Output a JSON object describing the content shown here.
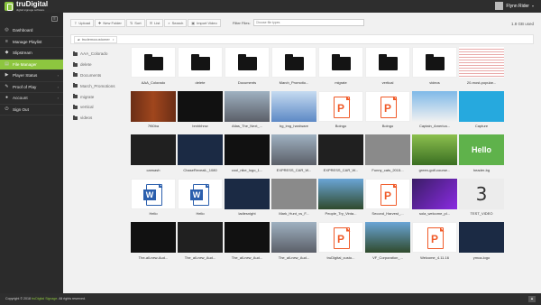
{
  "app": {
    "logo_text": "truDigital",
    "logo_subtext": "digital signage software"
  },
  "user": {
    "name": "Flynn Rider"
  },
  "nav": [
    {
      "label": "Dashboard",
      "icon": "dashboard-icon",
      "glyph": "◎"
    },
    {
      "label": "Manage Playlist",
      "icon": "playlist-icon",
      "glyph": "≡"
    },
    {
      "label": "Slipstream",
      "icon": "slipstream-icon",
      "glyph": "◆"
    },
    {
      "label": "File Manager",
      "icon": "folder-icon",
      "glyph": "▤",
      "active": true
    },
    {
      "label": "Player Status",
      "icon": "player-icon",
      "glyph": "▶",
      "chevron": true
    },
    {
      "label": "Proof of Play",
      "icon": "proof-icon",
      "glyph": "✎",
      "chevron": true
    },
    {
      "label": "Account",
      "icon": "account-icon",
      "glyph": "●",
      "chevron": true
    },
    {
      "label": "Sign Out",
      "icon": "signout-icon",
      "glyph": "⏻"
    }
  ],
  "toolbar": {
    "upload": "Upload",
    "new_folder": "New Folder",
    "sort": "Sort",
    "list": "List",
    "search": "Search",
    "import_video": "Import Video"
  },
  "filter": {
    "label": "Filter Files:",
    "placeholder": "Choose file types"
  },
  "usage": "1.8 GB used",
  "breadcrumb": {
    "label": "trudemocustomer"
  },
  "tree": [
    "AAA_Colorado",
    "delete",
    "Documents",
    "March_Promotions",
    "migrate",
    "vertical",
    "videos"
  ],
  "files": [
    {
      "name": "AAA_Colorado",
      "kind": "folder"
    },
    {
      "name": "delete",
      "kind": "folder"
    },
    {
      "name": "Documents",
      "kind": "folder"
    },
    {
      "name": "March_Promotio...",
      "kind": "folder"
    },
    {
      "name": "migrate",
      "kind": "folder"
    },
    {
      "name": "vertical",
      "kind": "folder"
    },
    {
      "name": "videos",
      "kind": "folder"
    },
    {
      "name": "20-most-popular...",
      "kind": "image",
      "style": "spread"
    },
    {
      "name": "7f60ba",
      "kind": "image",
      "style": "wood"
    },
    {
      "name": "bmhbhnw",
      "kind": "image",
      "style": "dark"
    },
    {
      "name": "Atlas_The_Next_...",
      "kind": "image",
      "style": "street"
    },
    {
      "name": "bg_img_hardware",
      "kind": "image",
      "style": "blue"
    },
    {
      "name": "Boingo",
      "kind": "pdf"
    },
    {
      "name": "Boingo",
      "kind": "pdf"
    },
    {
      "name": "Captain_America...",
      "kind": "image",
      "style": "sky"
    },
    {
      "name": "Capture",
      "kind": "image",
      "style": "cyan"
    },
    {
      "name": "carwash",
      "kind": "image",
      "style": "cover"
    },
    {
      "name": "ChaseRevealL_1080",
      "kind": "image",
      "style": "ink"
    },
    {
      "name": "cool_nike_logo_1...",
      "kind": "image",
      "style": "dark"
    },
    {
      "name": "EXPRESS_CAR_W...",
      "kind": "image",
      "style": "street"
    },
    {
      "name": "EXPRESS_CAR_W...",
      "kind": "image",
      "style": "cover"
    },
    {
      "name": "Funny_cats_2015...",
      "kind": "image",
      "style": "gray"
    },
    {
      "name": "green-golf-course...",
      "kind": "image",
      "style": "green"
    },
    {
      "name": "header-bg",
      "kind": "text",
      "text": "Hello World!"
    },
    {
      "name": "Hello",
      "kind": "word"
    },
    {
      "name": "Hello",
      "kind": "word"
    },
    {
      "name": "ladiesnight",
      "kind": "image",
      "style": "ink"
    },
    {
      "name": "Mark_Hunt_vs_F...",
      "kind": "image",
      "style": "gray"
    },
    {
      "name": "People_Try_Vinta...",
      "kind": "image",
      "style": "lake"
    },
    {
      "name": "Second_Harvest_...",
      "kind": "pdf"
    },
    {
      "name": "sola_welcome_pl...",
      "kind": "image",
      "style": "purple"
    },
    {
      "name": "TEST_VIDEO",
      "kind": "text",
      "text": "3"
    },
    {
      "name": "The-all-new-Aud...",
      "kind": "image",
      "style": "dark"
    },
    {
      "name": "The_all-new_Aud...",
      "kind": "image",
      "style": "cover"
    },
    {
      "name": "The_all-new_Aud...",
      "kind": "image",
      "style": "dark"
    },
    {
      "name": "The_all-new_Aud...",
      "kind": "image",
      "style": "street"
    },
    {
      "name": "truDigital_custo...",
      "kind": "pdf"
    },
    {
      "name": "VF_Corporation_...",
      "kind": "image",
      "style": "lake"
    },
    {
      "name": "Welcome_4.11.16",
      "kind": "pdf"
    },
    {
      "name": "ymca-logo",
      "kind": "image",
      "style": "ink"
    }
  ],
  "footer": {
    "prefix": "Copyright © 2018 ",
    "brand": "truDigital Signage",
    "suffix": ". All rights reserved."
  }
}
